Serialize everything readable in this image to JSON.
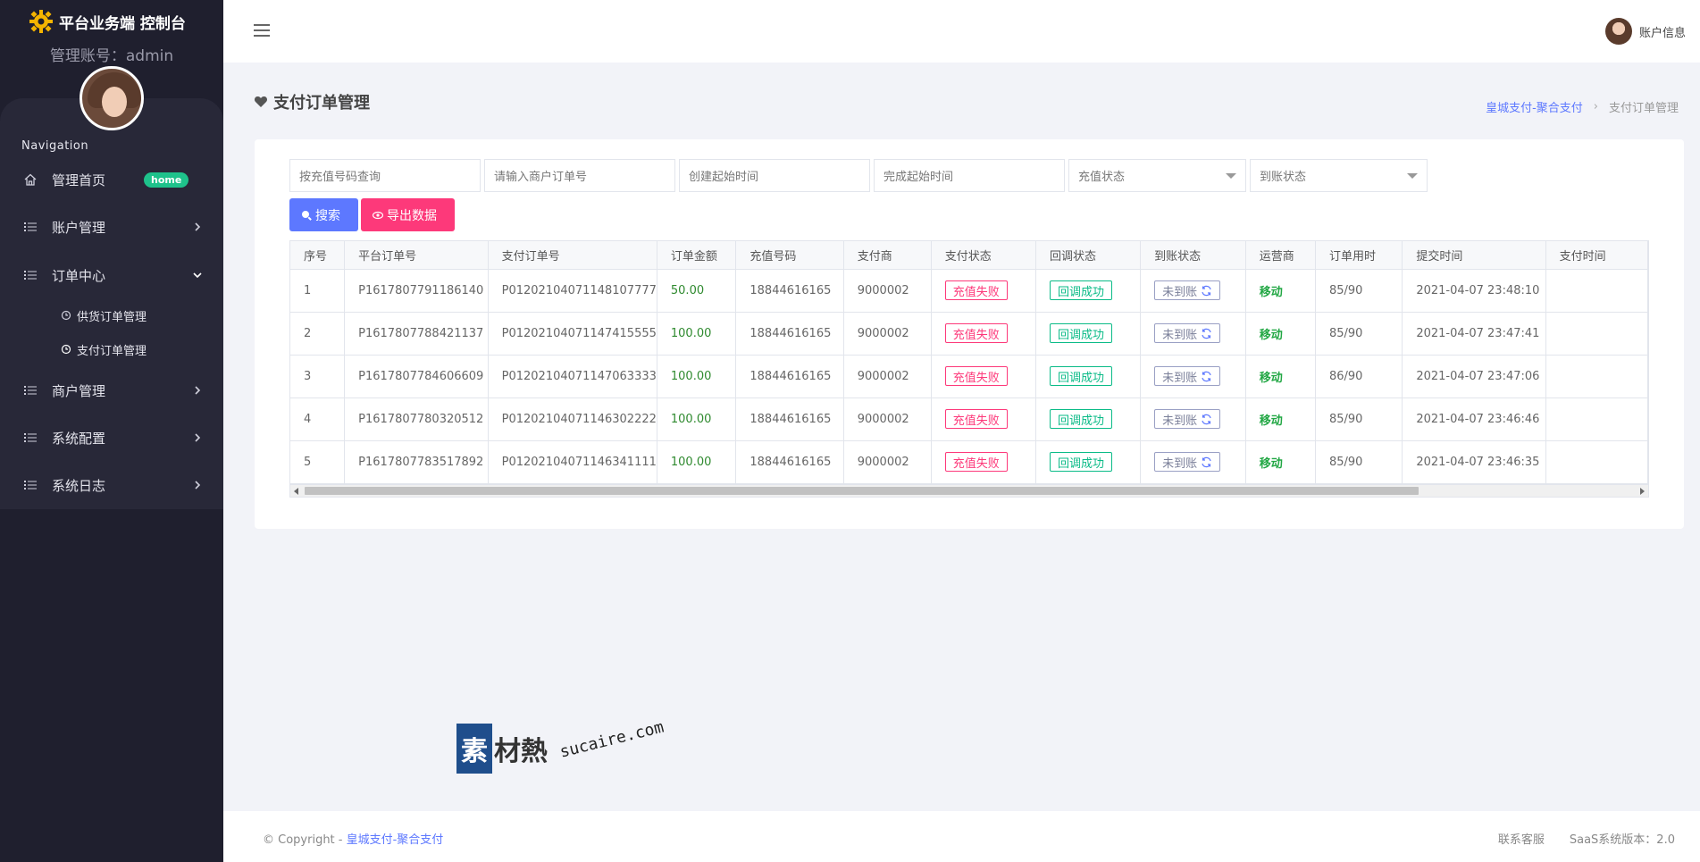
{
  "brand": {
    "title": "平台业务端 控制台",
    "account": "管理账号：admin"
  },
  "sidebar": {
    "heading": "Navigation",
    "home": {
      "label": "管理首页",
      "badge": "home"
    },
    "items": [
      {
        "label": "账户管理"
      },
      {
        "label": "订单中心"
      },
      {
        "label": "商户管理"
      },
      {
        "label": "系统配置"
      },
      {
        "label": "系统日志"
      }
    ],
    "sub_items": [
      {
        "label": "供货订单管理"
      },
      {
        "label": "支付订单管理"
      }
    ]
  },
  "header": {
    "user_label": "账户信息"
  },
  "page": {
    "title": "支付订单管理",
    "breadcrumb": {
      "root": "皇城支付-聚合支付",
      "sep": "›",
      "current": "支付订单管理"
    }
  },
  "filters": {
    "recharge_number": "按充值号码查询",
    "merchant_order": "请输入商户订单号",
    "create_time": "创建起始时间",
    "finish_time": "完成起始时间",
    "recharge_status": "充值状态",
    "arrival_status": "到账状态"
  },
  "buttons": {
    "search": "搜索",
    "export": "导出数据"
  },
  "table": {
    "columns": [
      "序号",
      "平台订单号",
      "支付订单号",
      "订单金额",
      "充值号码",
      "支付商",
      "支付状态",
      "回调状态",
      "到账状态",
      "运营商",
      "订单用时",
      "提交时间",
      "支付时间"
    ],
    "rows": [
      [
        "1",
        "P1617807791186140",
        "P01202104071148107777",
        "50.00",
        "18844616165",
        "9000002",
        "充值失败",
        "回调成功",
        "未到账",
        "移动",
        "85/90",
        "2021-04-07 23:48:10",
        ""
      ],
      [
        "2",
        "P1617807788421137",
        "P01202104071147415555",
        "100.00",
        "18844616165",
        "9000002",
        "充值失败",
        "回调成功",
        "未到账",
        "移动",
        "85/90",
        "2021-04-07 23:47:41",
        ""
      ],
      [
        "3",
        "P1617807784606609",
        "P01202104071147063333",
        "100.00",
        "18844616165",
        "9000002",
        "充值失败",
        "回调成功",
        "未到账",
        "移动",
        "86/90",
        "2021-04-07 23:47:06",
        ""
      ],
      [
        "4",
        "P1617807780320512",
        "P01202104071146302222",
        "100.00",
        "18844616165",
        "9000002",
        "充值失败",
        "回调成功",
        "未到账",
        "移动",
        "85/90",
        "2021-04-07 23:46:46",
        ""
      ],
      [
        "5",
        "P1617807783517892",
        "P01202104071146341111",
        "100.00",
        "18844616165",
        "9000002",
        "充值失败",
        "回调成功",
        "未到账",
        "移动",
        "85/90",
        "2021-04-07 23:46:35",
        ""
      ]
    ]
  },
  "watermark": {
    "mark": "素",
    "text": "材熱",
    "url": "sucaire.com"
  },
  "footer": {
    "copy_prefix": "© Copyright - ",
    "copy_link": "皇城支付-聚合支付",
    "contact": "联系客服",
    "version": "SaaS系统版本：2.0"
  },
  "colors": {
    "sidebar": "#1f1f2e",
    "accent": "#5d78ff",
    "danger": "#fd397a",
    "success": "#0abb87",
    "carrier": "#22a744"
  }
}
